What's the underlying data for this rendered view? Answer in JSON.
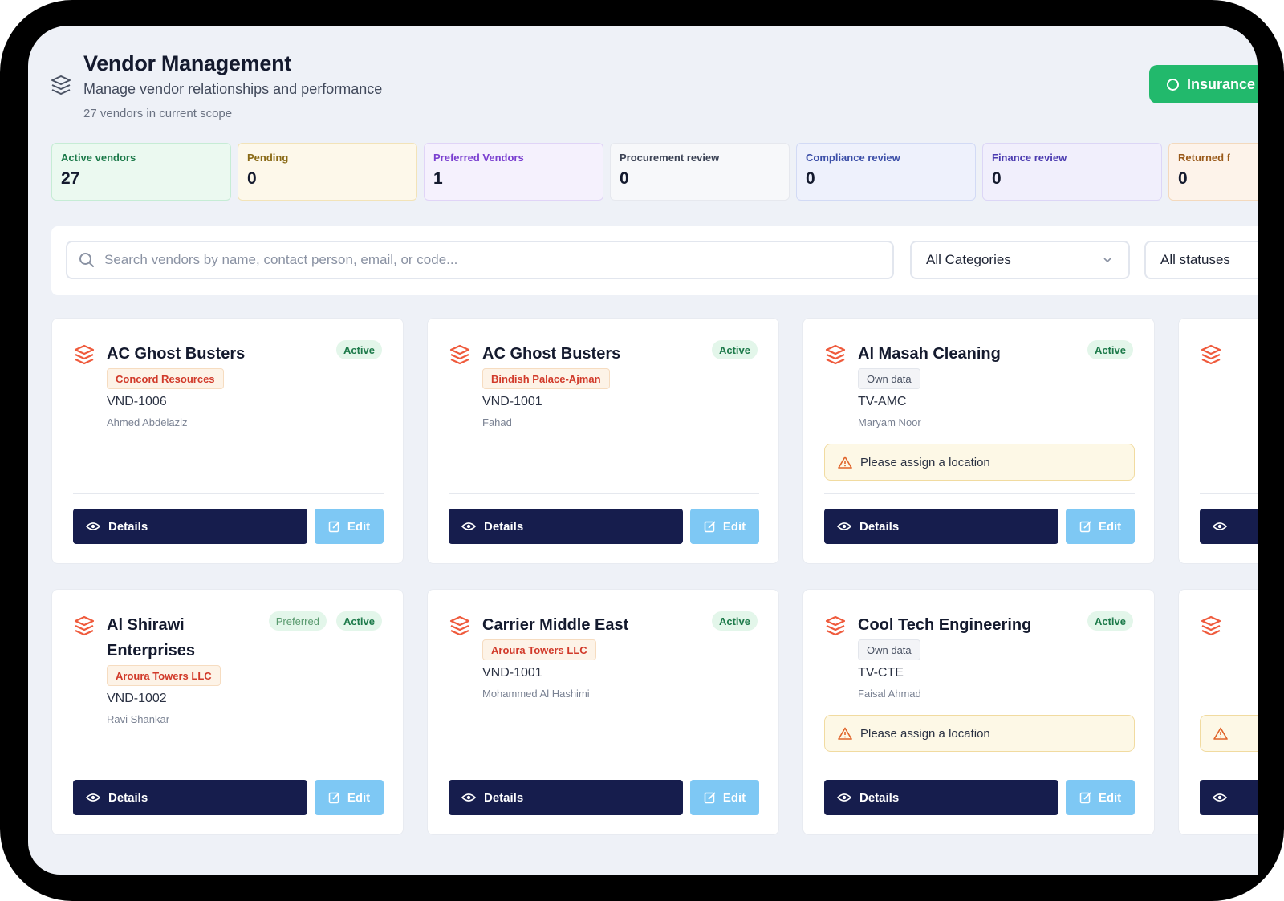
{
  "header": {
    "title": "Vendor Management",
    "subtitle": "Manage vendor relationships and performance",
    "scope": "27 vendors in current scope",
    "insurance_label": "Insurance"
  },
  "stats": [
    {
      "label": "Active vendors",
      "value": "27"
    },
    {
      "label": "Pending",
      "value": "0"
    },
    {
      "label": "Preferred Vendors",
      "value": "1"
    },
    {
      "label": "Procurement review",
      "value": "0"
    },
    {
      "label": "Compliance review",
      "value": "0"
    },
    {
      "label": "Finance review",
      "value": "0"
    },
    {
      "label": "Returned f",
      "value": "0"
    }
  ],
  "filters": {
    "search_placeholder": "Search vendors by name, contact person, email, or code...",
    "category_value": "All Categories",
    "status_value": "All statuses"
  },
  "card_labels": {
    "details": "Details",
    "edit": "Edit",
    "warning": "Please assign a location",
    "active": "Active",
    "preferred": "Preferred"
  },
  "vendors": [
    {
      "name": "AC Ghost Busters",
      "org": "Concord Resources",
      "code": "VND-1006",
      "contact": "Ahmed Abdelaziz"
    },
    {
      "name": "AC Ghost Busters",
      "org": "Bindish Palace-Ajman",
      "code": "VND-1001",
      "contact": "Fahad"
    },
    {
      "name": "Al Masah Cleaning",
      "org": "Own data",
      "code": "TV-AMC",
      "contact": "Maryam Noor"
    },
    {
      "name_line1": "Al Shirawi",
      "name_line2": "Enterprises",
      "org": "Aroura Towers LLC",
      "code": "VND-1002",
      "contact": "Ravi Shankar"
    },
    {
      "name": "Carrier Middle East",
      "org": "Aroura Towers LLC",
      "code": "VND-1001",
      "contact": "Mohammed Al Hashimi"
    },
    {
      "name": "Cool Tech Engineering",
      "org": "Own data",
      "code": "TV-CTE",
      "contact": "Faisal Ahmad"
    }
  ],
  "colors": {
    "primary_dark": "#161d4d",
    "edit_blue": "#7ec8f4",
    "success": "#22b96c",
    "vendor_icon": "#ef5a3c"
  }
}
